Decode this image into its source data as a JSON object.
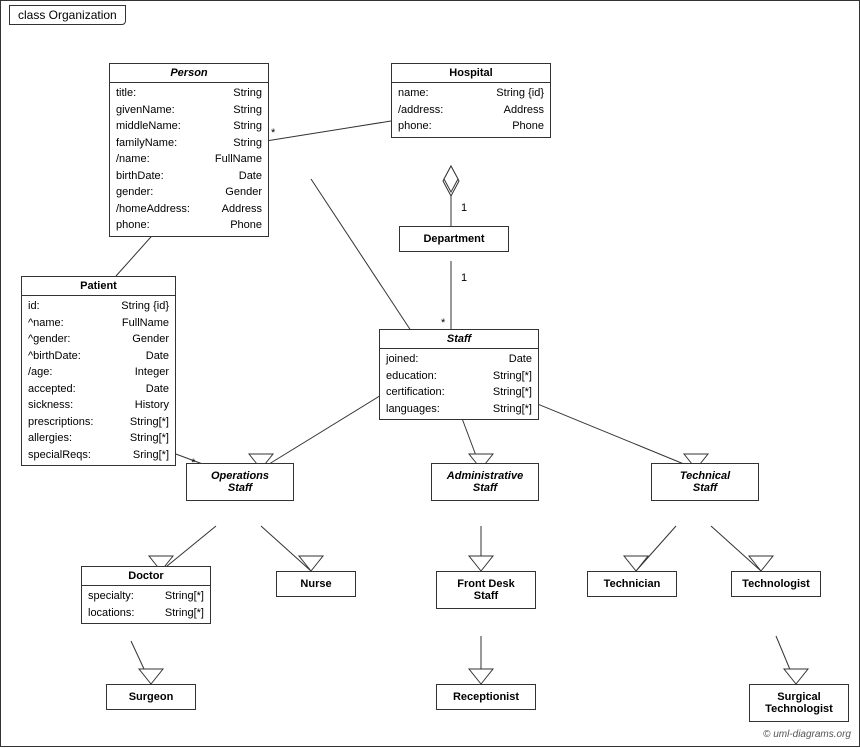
{
  "title": "class Organization",
  "classes": {
    "person": {
      "name": "Person",
      "attrs": [
        {
          "name": "title:",
          "type": "String"
        },
        {
          "name": "givenName:",
          "type": "String"
        },
        {
          "name": "middleName:",
          "type": "String"
        },
        {
          "name": "familyName:",
          "type": "String"
        },
        {
          "name": "/name:",
          "type": "FullName"
        },
        {
          "name": "birthDate:",
          "type": "Date"
        },
        {
          "name": "gender:",
          "type": "Gender"
        },
        {
          "name": "/homeAddress:",
          "type": "Address"
        },
        {
          "name": "phone:",
          "type": "Phone"
        }
      ]
    },
    "hospital": {
      "name": "Hospital",
      "attrs": [
        {
          "name": "name:",
          "type": "String {id}"
        },
        {
          "name": "/address:",
          "type": "Address"
        },
        {
          "name": "phone:",
          "type": "Phone"
        }
      ]
    },
    "patient": {
      "name": "Patient",
      "attrs": [
        {
          "name": "id:",
          "type": "String {id}"
        },
        {
          "name": "^name:",
          "type": "FullName"
        },
        {
          "name": "^gender:",
          "type": "Gender"
        },
        {
          "name": "^birthDate:",
          "type": "Date"
        },
        {
          "name": "/age:",
          "type": "Integer"
        },
        {
          "name": "accepted:",
          "type": "Date"
        },
        {
          "name": "sickness:",
          "type": "History"
        },
        {
          "name": "prescriptions:",
          "type": "String[*]"
        },
        {
          "name": "allergies:",
          "type": "String[*]"
        },
        {
          "name": "specialReqs:",
          "type": "Sring[*]"
        }
      ]
    },
    "department": {
      "name": "Department"
    },
    "staff": {
      "name": "Staff",
      "attrs": [
        {
          "name": "joined:",
          "type": "Date"
        },
        {
          "name": "education:",
          "type": "String[*]"
        },
        {
          "name": "certification:",
          "type": "String[*]"
        },
        {
          "name": "languages:",
          "type": "String[*]"
        }
      ]
    },
    "operations_staff": {
      "name": "Operations\nStaff"
    },
    "administrative_staff": {
      "name": "Administrative\nStaff"
    },
    "technical_staff": {
      "name": "Technical\nStaff"
    },
    "doctor": {
      "name": "Doctor",
      "attrs": [
        {
          "name": "specialty:",
          "type": "String[*]"
        },
        {
          "name": "locations:",
          "type": "String[*]"
        }
      ]
    },
    "nurse": {
      "name": "Nurse"
    },
    "front_desk_staff": {
      "name": "Front Desk\nStaff"
    },
    "technician": {
      "name": "Technician"
    },
    "technologist": {
      "name": "Technologist"
    },
    "surgeon": {
      "name": "Surgeon"
    },
    "receptionist": {
      "name": "Receptionist"
    },
    "surgical_technologist": {
      "name": "Surgical\nTechnologist"
    }
  },
  "multiplicity": {
    "star": "*",
    "one": "1"
  },
  "copyright": "© uml-diagrams.org"
}
